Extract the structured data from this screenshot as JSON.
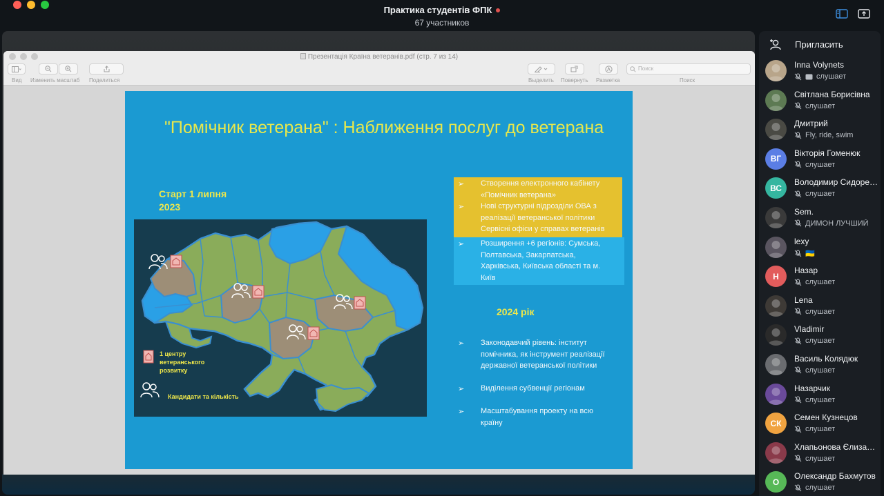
{
  "window": {
    "title": "Практика студентів ФПК",
    "subtitle": "67 участников",
    "colors": {
      "close": "#fe5f57",
      "minimize": "#febc2e",
      "zoom": "#28c840",
      "recording": "#e0524f"
    }
  },
  "preview": {
    "title": "Презентація Країна ветеранів.pdf (стр. 7 из 14)",
    "toolbar": {
      "view": "Вид",
      "zoom": "Изменить масштаб",
      "share": "Поделиться",
      "markup_select": "Выделить",
      "rotate": "Повернуть",
      "markup": "Разметка",
      "search_label": "Поиск",
      "search_placeholder": "Поиск"
    }
  },
  "slide": {
    "title": "\"Помічник ветерана\" : Наближення послуг до ветерана",
    "start_line1": "Старт 1 липня",
    "start_line2": "2023",
    "legend_center_l1": "1 центру",
    "legend_center_l2": "ветеранського",
    "legend_center_l3": "розвитку",
    "legend_candidates": "Кандидати та кількість",
    "yellow_item1_l1": "Створення електронного кабінету",
    "yellow_item1_l2": "«Помічник ветерана»",
    "yellow_item2_l1": "Нові структурні підрозділи ОВА з",
    "yellow_item2_l2": "реалізації ветеранської політики",
    "yellow_item2_l3": "Сервісні офіси у справах ветеранів",
    "blue_item_l1": "Розширення +6 регіонів: Сумська,",
    "blue_item_l2": "Полтавська, Закарпатська,",
    "blue_item_l3": "Харківська, Київська області та м.",
    "blue_item_l4": "Київ",
    "year": "2024 рік",
    "item_a_l1": "Законодавчий рівень: інститут",
    "item_a_l2": "помічника, як інструмент реалізації",
    "item_a_l3": "державної ветеранської політики",
    "item_b": "Виділення субвенції регіонам",
    "item_c_l1": "Масштабування проекту на всю",
    "item_c_l2": "країну",
    "bullet": "➢",
    "colors": {
      "background": "#1b9ad2",
      "title": "#e8e84b",
      "highlight": "#e5c12f",
      "map_green": "#8aac5a",
      "map_brown": "#9d8e77"
    }
  },
  "sidebar": {
    "invite_label": "Пригласить",
    "participants": [
      {
        "name": "Inna Volynets",
        "status": "слушает",
        "initials": "",
        "color": "#b8a58a"
      },
      {
        "name": "Світлана Борисівна",
        "status": "слушает",
        "initials": "",
        "color": "#5d7a53"
      },
      {
        "name": "Дмитрий",
        "status": "Fly, ride, swim",
        "initials": "",
        "color": "#4a4a44"
      },
      {
        "name": "Вікторія Гоменюк",
        "status": "слушает",
        "initials": "ВГ",
        "color": "#5b7ee5"
      },
      {
        "name": "Володимир Сидоренко",
        "status": "слушает",
        "initials": "ВС",
        "color": "#35b6a0"
      },
      {
        "name": "Sem.",
        "status": "ДИМОН ЛУЧШИЙ",
        "initials": "",
        "color": "#3a3a3a"
      },
      {
        "name": "lexy",
        "status": "🇺🇦",
        "initials": "",
        "color": "#5a5560"
      },
      {
        "name": "Назар",
        "status": "слушает",
        "initials": "Н",
        "color": "#e25c5c"
      },
      {
        "name": "Lena",
        "status": "слушает",
        "initials": "",
        "color": "#3e3a36"
      },
      {
        "name": "Vladimir",
        "status": "слушает",
        "initials": "",
        "color": "#2a2a2a"
      },
      {
        "name": "Василь Колядюк",
        "status": "слушает",
        "initials": "",
        "color": "#6a6c70"
      },
      {
        "name": "Назарчик",
        "status": "слушает",
        "initials": "",
        "color": "#6a4a9a"
      },
      {
        "name": "Семен Кузнецов",
        "status": "слушает",
        "initials": "СК",
        "color": "#f0a340"
      },
      {
        "name": "Хлапьонова Єлизавета",
        "status": "слушает",
        "initials": "",
        "color": "#8a3a4a"
      },
      {
        "name": "Олександр Бахмутов",
        "status": "слушает",
        "initials": "О",
        "color": "#57b857"
      }
    ]
  }
}
